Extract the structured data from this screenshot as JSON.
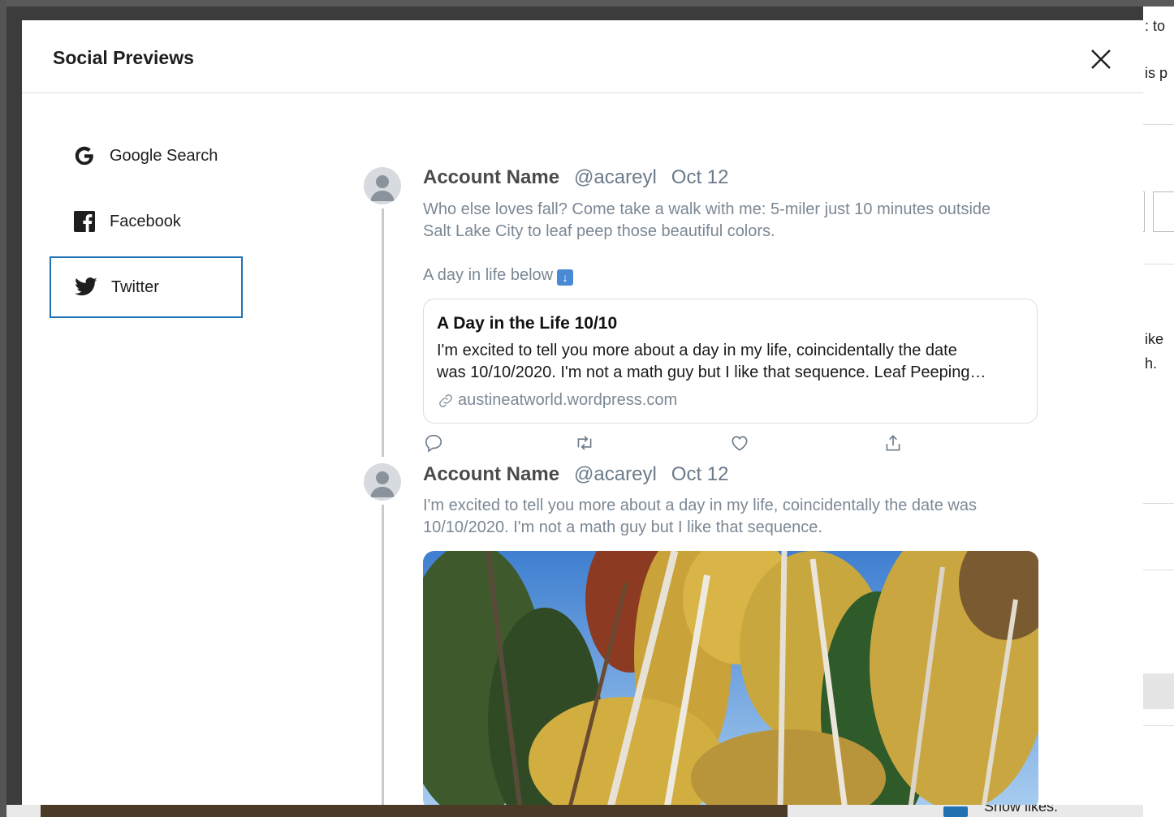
{
  "modal": {
    "title": "Social Previews",
    "close_label": "Close"
  },
  "sidebar": {
    "items": [
      {
        "label": "Google Search",
        "icon": "google-icon",
        "active": false
      },
      {
        "label": "Facebook",
        "icon": "facebook-icon",
        "active": false
      },
      {
        "label": "Twitter",
        "icon": "twitter-icon",
        "active": true
      }
    ]
  },
  "tweets": [
    {
      "name": "Account Name",
      "handle": "@acareyl",
      "date": "Oct 12",
      "text_line1": "Who else loves fall? Come take a walk with me: 5-miler just 10 minutes outside",
      "text_line2": "Salt Lake City to leaf peep those beautiful colors.",
      "text_line3": "A day in life below",
      "emoji": "⬇️",
      "card": {
        "title": "A Day in the Life 10/10",
        "desc_line1": "I'm excited to tell you more about a day in my life, coincidentally the date",
        "desc_line2": "was 10/10/2020. I'm not a math guy but I like that sequence. Leaf Peeping…",
        "url": "austineatworld.wordpress.com"
      },
      "actions": [
        "reply-icon",
        "retweet-icon",
        "like-icon",
        "share-icon"
      ]
    },
    {
      "name": "Account Name",
      "handle": "@acareyl",
      "date": "Oct 12",
      "text_line1": "I'm excited to tell you more about a day in my life, coincidentally the date was",
      "text_line2": "10/10/2020. I'm not a math guy but I like that sequence."
    }
  ],
  "background": {
    "right_fragments": [
      ": to",
      "is p",
      "ike",
      "h."
    ],
    "bottom_text": "Show likes."
  },
  "colors": {
    "accent": "#2271b1",
    "thread_line": "#c4cbd1",
    "muted_text": "#7b8894"
  }
}
